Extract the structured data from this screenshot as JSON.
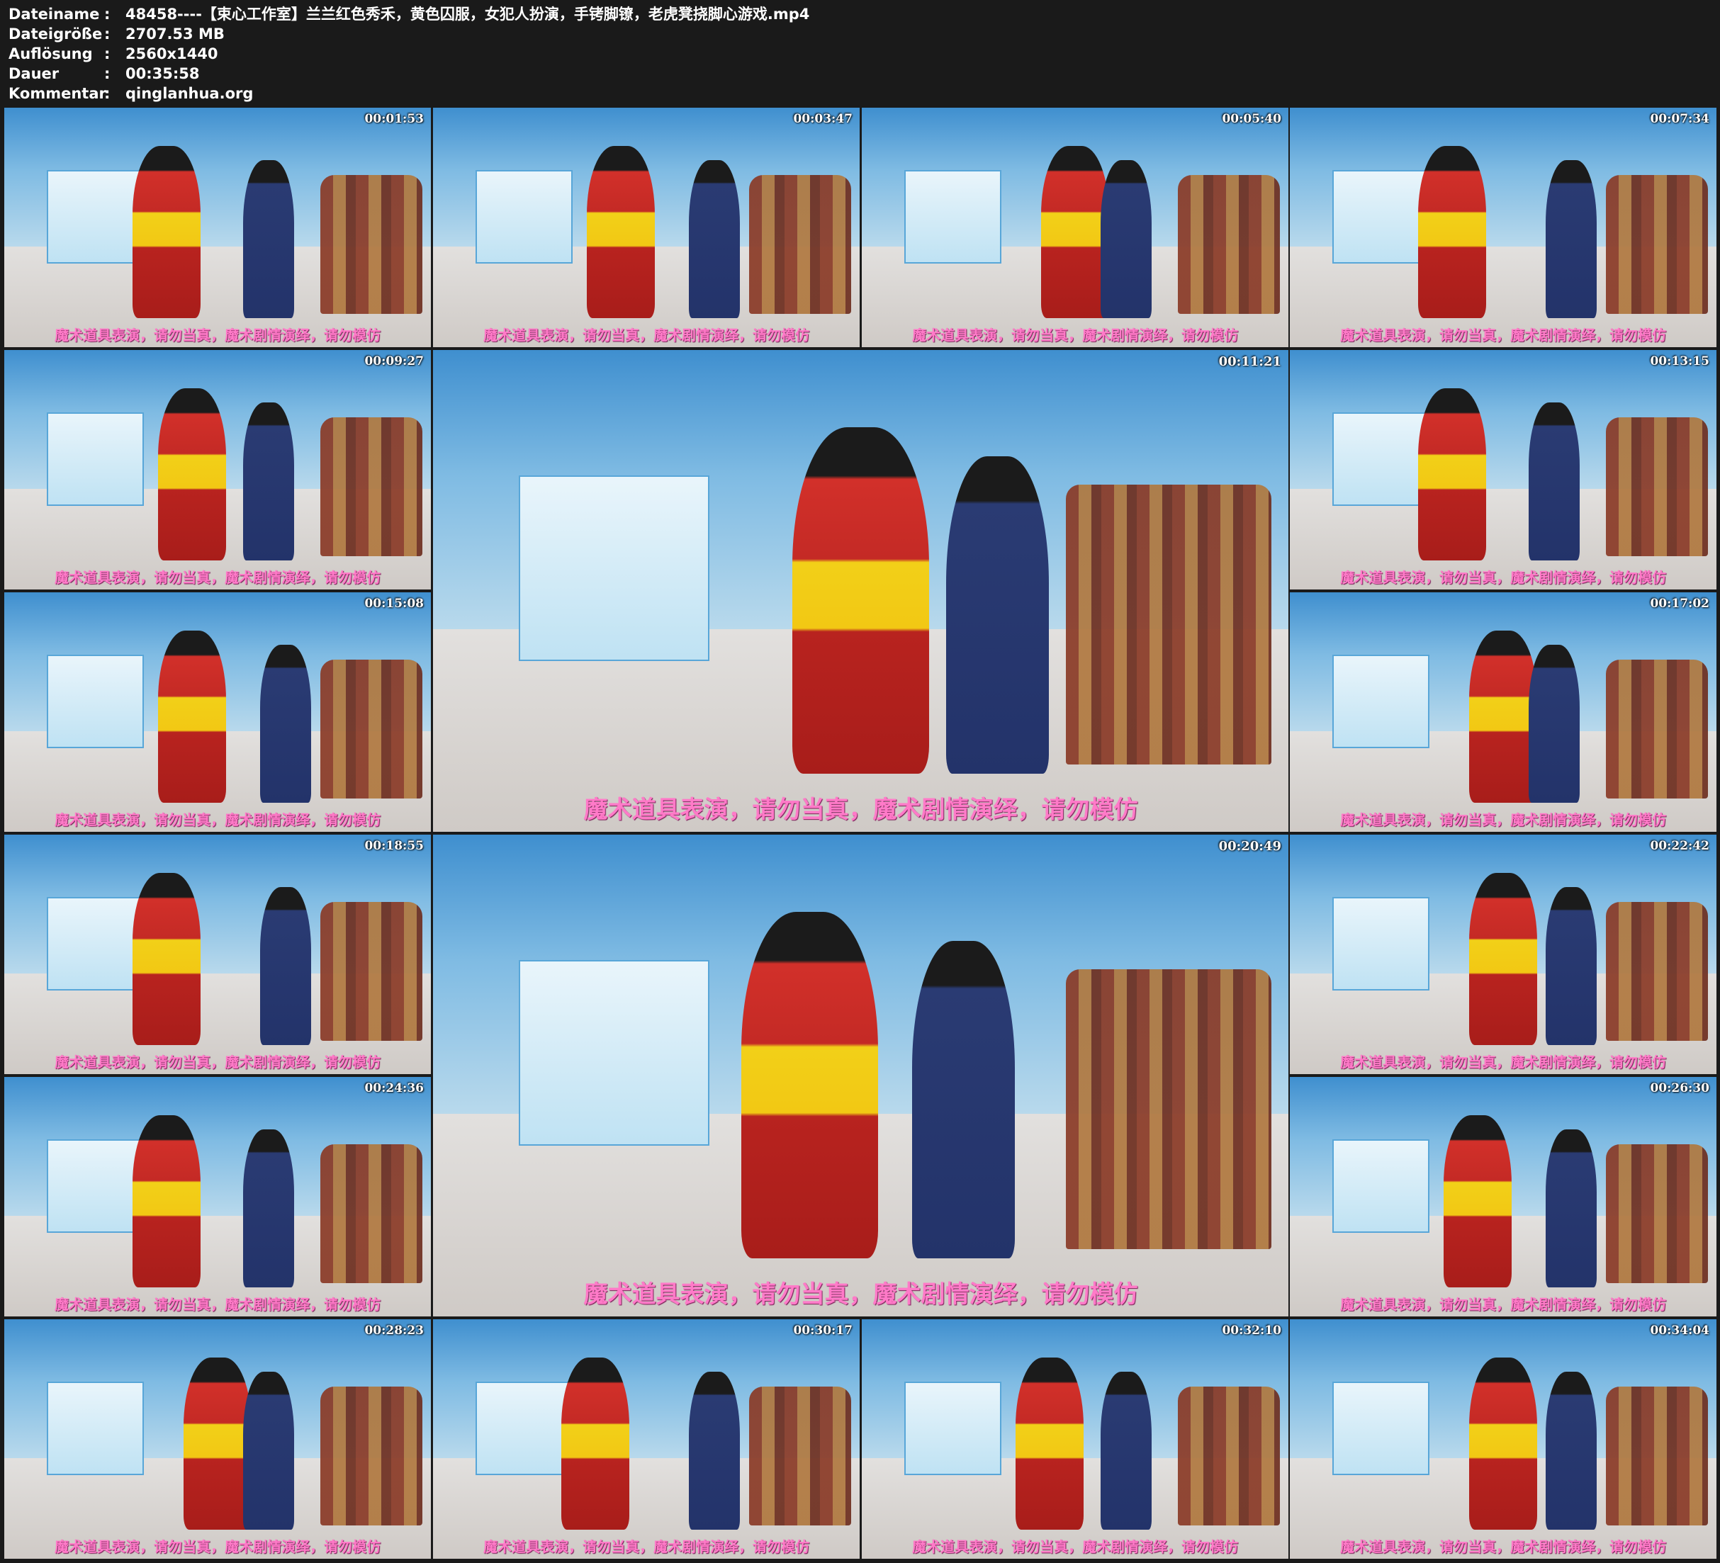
{
  "meta": {
    "rows": [
      {
        "key": "Dateiname",
        "sep": ":",
        "value": "48458----【束心工作室】兰兰红色秀禾，黄色囚服，女犯人扮演，手铐脚镣，老虎凳挠脚心游戏.mp4"
      },
      {
        "key": "Dateigröße",
        "sep": ":",
        "value": "2707.53 MB"
      },
      {
        "key": "Auflösung",
        "sep": ":",
        "value": "2560x1440"
      },
      {
        "key": "Dauer",
        "sep": ":",
        "value": "00:35:58"
      },
      {
        "key": "Kommentar",
        "sep": ":",
        "value": "qinglanhua.org"
      }
    ]
  },
  "caption_text": "魔术道具表演，请勿当真，魔术剧情演绎，请勿模仿",
  "thumbnails": [
    {
      "timestamp": "00:01:53"
    },
    {
      "timestamp": "00:03:47"
    },
    {
      "timestamp": "00:05:40"
    },
    {
      "timestamp": "00:07:34"
    },
    {
      "timestamp": "00:09:27"
    },
    {
      "timestamp": "00:11:21"
    },
    {
      "timestamp": "00:13:15"
    },
    {
      "timestamp": "00:15:08"
    },
    {
      "timestamp": "00:17:02"
    },
    {
      "timestamp": "00:18:55"
    },
    {
      "timestamp": "00:20:49"
    },
    {
      "timestamp": "00:22:42"
    },
    {
      "timestamp": "00:24:36"
    },
    {
      "timestamp": "00:26:30"
    },
    {
      "timestamp": "00:28:23"
    },
    {
      "timestamp": "00:30:17"
    },
    {
      "timestamp": "00:32:10"
    },
    {
      "timestamp": "00:34:04"
    }
  ]
}
